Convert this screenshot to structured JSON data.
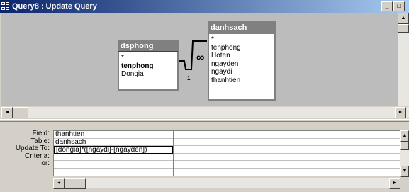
{
  "window": {
    "title": "Query8 : Update Query"
  },
  "tables": [
    {
      "name": "dsphong",
      "fields": [
        "*",
        "tenphong",
        "Dongia"
      ],
      "key_field": "tenphong"
    },
    {
      "name": "danhsach",
      "fields": [
        "*",
        "tenphong",
        "Hoten",
        "ngayden",
        "ngaydi",
        "thanhtien"
      ]
    }
  ],
  "relationship": {
    "one_side": "1",
    "many_side": "∞"
  },
  "grid": {
    "row_labels": [
      "Field:",
      "Table:",
      "Update To:",
      "Criteria:",
      "or:"
    ],
    "columns": [
      {
        "field": "thanhtien",
        "table": "danhsach",
        "update_to": "[dongia]*([ngaydi]-[ngayden])",
        "criteria": "",
        "or": ""
      },
      {
        "field": "",
        "table": "",
        "update_to": "",
        "criteria": "",
        "or": ""
      },
      {
        "field": "",
        "table": "",
        "update_to": "",
        "criteria": "",
        "or": ""
      },
      {
        "field": "",
        "table": "",
        "update_to": "",
        "criteria": "",
        "or": ""
      }
    ]
  },
  "colors": {
    "titlebar_start": "#0a246a",
    "titlebar_end": "#a6caf0",
    "table_pane_bg": "#bcbcbc",
    "field_list_title": "#808080"
  }
}
